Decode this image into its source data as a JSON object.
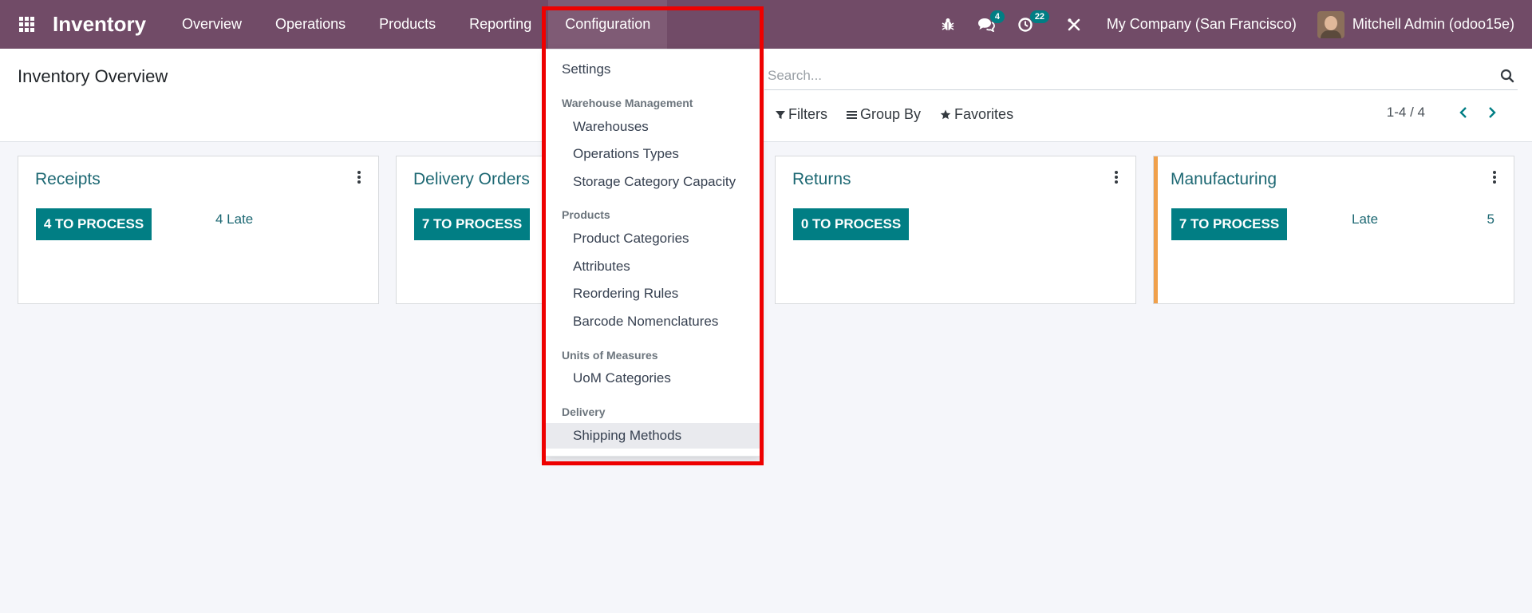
{
  "navbar": {
    "brand": "Inventory",
    "menu": [
      "Overview",
      "Operations",
      "Products",
      "Reporting",
      "Configuration"
    ],
    "active_menu": "Configuration",
    "messages_count": "4",
    "activities_count": "22",
    "company": "My Company (San Francisco)",
    "user": "Mitchell Admin (odoo15e)"
  },
  "control_panel": {
    "title": "Inventory Overview",
    "search_placeholder": "Search...",
    "filters_label": "Filters",
    "group_by_label": "Group By",
    "favorites_label": "Favorites",
    "pager_value": "1-4 / 4"
  },
  "cards": [
    {
      "title": "Receipts",
      "button": "4 TO PROCESS",
      "link": "4 Late",
      "count": ""
    },
    {
      "title": "Delivery Orders",
      "button": "7 TO PROCESS",
      "link": "",
      "count": ""
    },
    {
      "title": "Returns",
      "button": "0 TO PROCESS",
      "link": "",
      "count": ""
    },
    {
      "title": "Manufacturing",
      "button": "7 TO PROCESS",
      "link": "Late",
      "count": "5"
    }
  ],
  "dropdown": {
    "settings": "Settings",
    "sections": [
      {
        "header": "Warehouse Management",
        "items": [
          "Warehouses",
          "Operations Types",
          "Storage Category Capacity"
        ]
      },
      {
        "header": "Products",
        "items": [
          "Product Categories",
          "Attributes",
          "Reordering Rules",
          "Barcode Nomenclatures"
        ]
      },
      {
        "header": "Units of Measures",
        "items": [
          "UoM Categories"
        ]
      },
      {
        "header": "Delivery",
        "items": [
          "Shipping Methods"
        ]
      }
    ],
    "hovered_item": "Shipping Methods"
  },
  "colors": {
    "navbar": "#714b67",
    "primary_button": "#017e84",
    "link": "#1d6873",
    "highlight": "#ee0000",
    "card_accent": "#f0a04b"
  }
}
